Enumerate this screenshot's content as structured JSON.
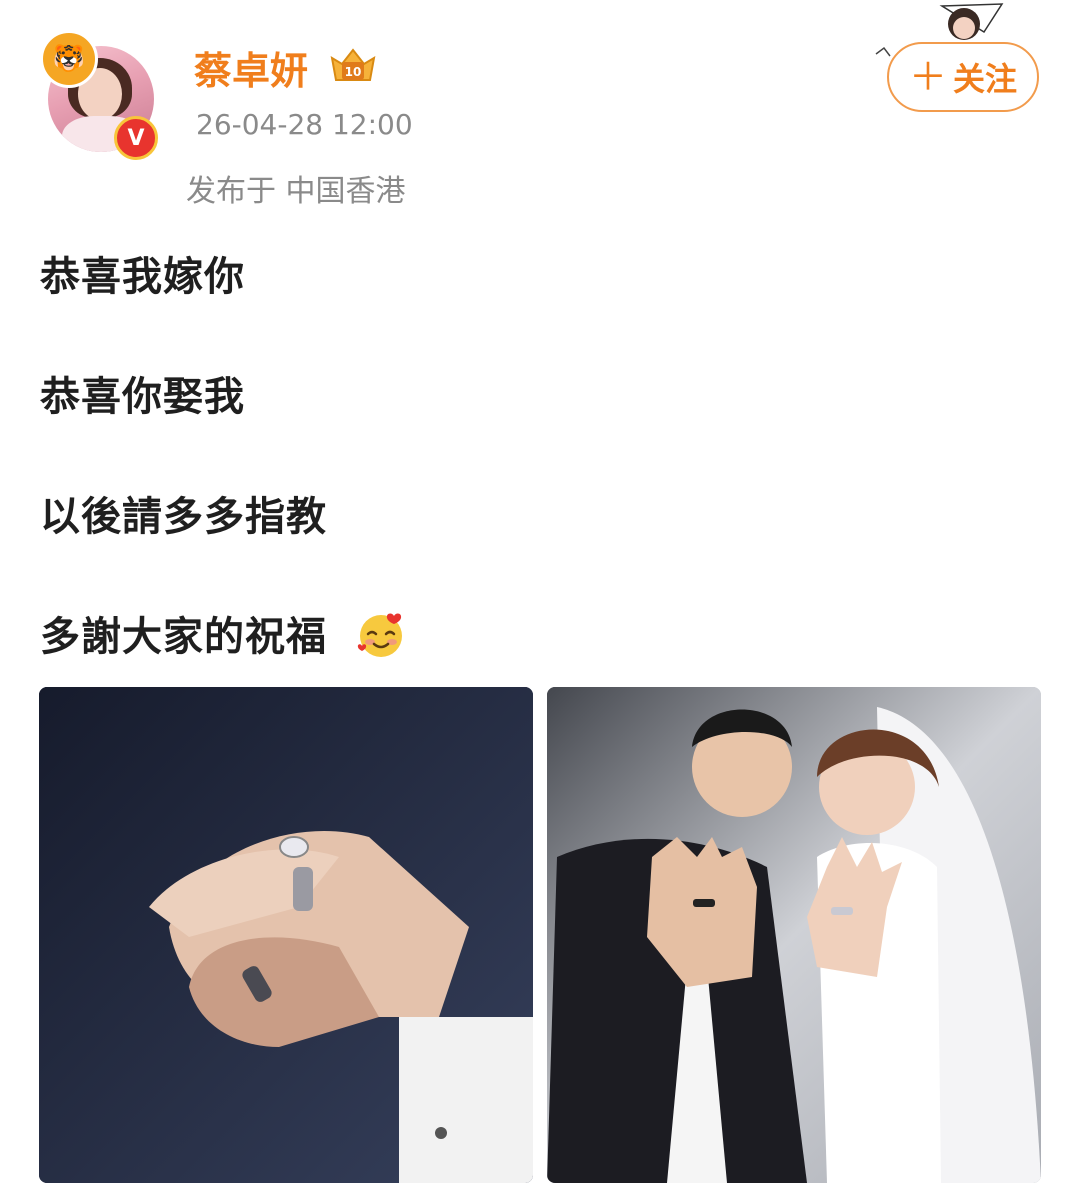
{
  "header": {
    "username": "蔡卓妍",
    "timestamp": "26-04-28 12:00",
    "location": "发布于 中国香港",
    "level_badge_icon": "level-10-crown-icon",
    "vip_badge_text": "V",
    "follow_label": "关注",
    "follow_icon": "plus-icon",
    "accent_color": "#f07e1c"
  },
  "post": {
    "lines": [
      "恭喜我嫁你",
      "恭喜你娶我",
      "以後請多多指教",
      "多謝大家的祝福"
    ],
    "emoji": "smiling-face-with-hearts-emoji"
  },
  "photos": [
    {
      "name": "wedding-rings-hands-photo"
    },
    {
      "name": "couple-showing-rings-photo"
    }
  ]
}
